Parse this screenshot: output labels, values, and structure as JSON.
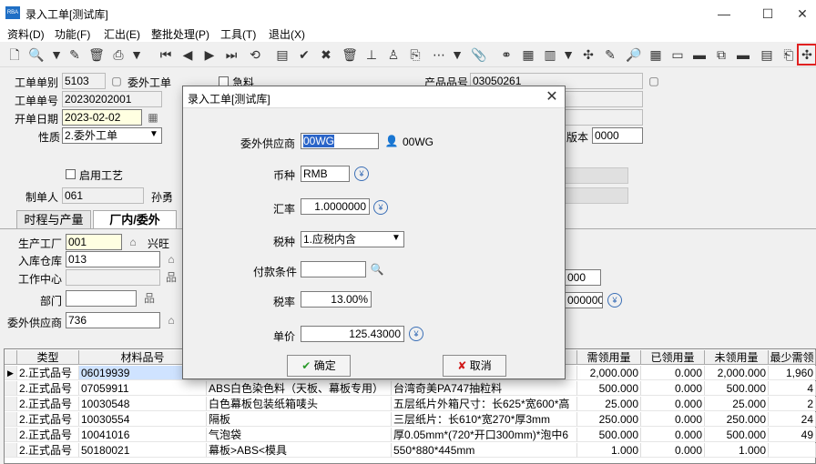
{
  "window": {
    "title": "录入工单[测试库]",
    "app_icon": "RBA"
  },
  "menu": [
    "资料(D)",
    "功能(F)",
    "汇出(E)",
    "整批处理(P)",
    "工具(T)",
    "退出(X)"
  ],
  "header": {
    "order_type_label": "工单单别",
    "order_type": "5103",
    "order_type_name": "委外工单",
    "urgent_label": "急料",
    "order_no_label": "工单单号",
    "order_no": "20230202001",
    "date_label": "开单日期",
    "date": "2023-02-02",
    "nature_label": "性质",
    "nature": "2.委外工单",
    "product_no_label": "产品品号",
    "product_no": "03050261",
    "version_label": "版本",
    "version": "0000",
    "enable_process_label": "启用工艺",
    "creator_label": "制单人",
    "creator_id": "061",
    "creator_name": "孙勇"
  },
  "tabs": [
    "时程与产量",
    "厂内/委外"
  ],
  "factory": {
    "plant_label": "生产工厂",
    "plant": "001",
    "plant_name": "兴旺",
    "warehouse_label": "入库仓库",
    "warehouse": "013",
    "work_center_label": "工作中心",
    "dept_label": "部门",
    "supplier_label": "委外供应商",
    "supplier": "736",
    "behind_val1": "000",
    "behind_val2": "000000"
  },
  "grid": {
    "headers": [
      "类型",
      "材料品号",
      "",
      "",
      "需领用量",
      "已领用量",
      "未领用量",
      "最少需领"
    ],
    "rows": [
      {
        "type": "2.正式品号",
        "no": "06019939",
        "name": "",
        "spec": "",
        "need": "2,000.000",
        "taken": "0.000",
        "remain": "2,000.000",
        "min": "1,960"
      },
      {
        "type": "2.正式品号",
        "no": "07059911",
        "name": "ABS白色染色料（天板、幕板专用）",
        "spec": "台湾奇美PA747抽粒料",
        "need": "500.000",
        "taken": "0.000",
        "remain": "500.000",
        "min": "4"
      },
      {
        "type": "2.正式品号",
        "no": "10030548",
        "name": "白色幕板包装纸箱唛头",
        "spec": "五层纸片外箱尺寸：长625*宽600*高",
        "need": "25.000",
        "taken": "0.000",
        "remain": "25.000",
        "min": "2"
      },
      {
        "type": "2.正式品号",
        "no": "10030554",
        "name": "隔板",
        "spec": "三层纸片：长610*宽270*厚3mm",
        "need": "250.000",
        "taken": "0.000",
        "remain": "250.000",
        "min": "24"
      },
      {
        "type": "2.正式品号",
        "no": "10041016",
        "name": "气泡袋",
        "spec": "厚0.05mm*(720*开口300mm)*泡中6",
        "need": "500.000",
        "taken": "0.000",
        "remain": "500.000",
        "min": "49"
      },
      {
        "type": "2.正式品号",
        "no": "50180021",
        "name": "幕板>ABS<模具",
        "spec": "550*880*445mm",
        "need": "1.000",
        "taken": "0.000",
        "remain": "1.000",
        "min": ""
      }
    ]
  },
  "dialog": {
    "title": "录入工单[测试库]",
    "supplier_label": "委外供应商",
    "supplier": "00WG",
    "supplier_name": "00WG",
    "currency_label": "币种",
    "currency": "RMB",
    "rate_label": "汇率",
    "rate": "1.0000000",
    "tax_type_label": "税种",
    "tax_type": "1.应税内含",
    "payment_label": "付款条件",
    "payment": "",
    "tax_rate_label": "税率",
    "tax_rate": "13.00%",
    "price_label": "单价",
    "price": "125.43000",
    "ok_label": "确定",
    "cancel_label": "取消"
  }
}
